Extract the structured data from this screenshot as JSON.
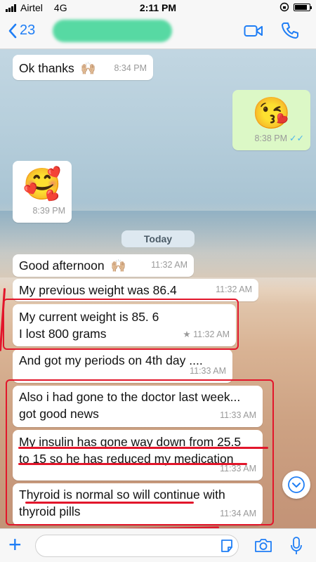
{
  "status": {
    "carrier": "Airtel",
    "network": "4G",
    "time": "2:11 PM",
    "battery_level": 0.85
  },
  "header": {
    "back_count": "23",
    "icons": [
      "video-call-icon",
      "phone-call-icon"
    ]
  },
  "messages": [
    {
      "dir": "in",
      "text": "Ok thanks",
      "emoji": "🙌🏼",
      "time": "8:34 PM"
    },
    {
      "dir": "out",
      "emoji": "😘",
      "time": "8:38 PM",
      "ticks": "✓✓"
    },
    {
      "dir": "in",
      "emoji": "🥰",
      "time": "8:39 PM"
    },
    {
      "dir": "in",
      "text": "Good afternoon",
      "emoji": "🙌🏼",
      "time": "11:32 AM"
    },
    {
      "dir": "in",
      "text": "My previous weight was 86.4",
      "time": "11:32 AM"
    },
    {
      "dir": "in",
      "line1": "My current weight is 85. 6",
      "line2": "I lost 800 grams",
      "time": "★ 11:32 AM"
    },
    {
      "dir": "in",
      "text": "And got my periods on 4th day ....",
      "time": "11:33 AM"
    },
    {
      "dir": "in",
      "line1": "Also i had gone to the doctor last week...",
      "line2": "got good news",
      "time": "11:33 AM"
    },
    {
      "dir": "in",
      "line1": "My insulin has gone way down from 25.5",
      "line2": "to 15 so he has reduced my medication",
      "time": "11:33 AM"
    },
    {
      "dir": "in",
      "line1": "Thyroid is normal so will continue with",
      "line2": "thyroid pills",
      "time": "11:34 AM"
    }
  ],
  "date_divider": "Today",
  "input": {
    "placeholder": ""
  },
  "colors": {
    "accent": "#1f7ef5",
    "annotation": "#e2162b",
    "outgoing": "#dcf8c6"
  }
}
